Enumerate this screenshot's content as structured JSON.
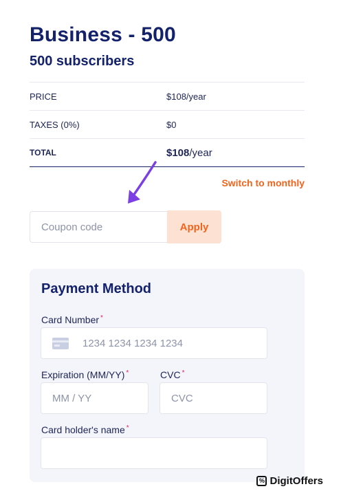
{
  "plan": {
    "title": "Business - 500",
    "subtitle": "500 subscribers"
  },
  "summary": {
    "price_label": "PRICE",
    "price_value": "$108/year",
    "taxes_label": "TAXES (0%)",
    "taxes_value": "$0",
    "total_label": "TOTAL",
    "total_amount": "$108",
    "total_suffix": "/year"
  },
  "switch_link": "Switch to monthly",
  "coupon": {
    "placeholder": "Coupon code",
    "apply_label": "Apply"
  },
  "payment": {
    "heading": "Payment Method",
    "card_number_label": "Card Number",
    "card_number_placeholder": "1234 1234 1234 1234",
    "expiration_label": "Expiration (MM/YY)",
    "expiration_placeholder": "MM / YY",
    "cvc_label": "CVC",
    "cvc_placeholder": "CVC",
    "holder_label": "Card holder's name",
    "required_mark": "*"
  },
  "watermark": {
    "icon_glyph": "%",
    "text": "DigitOffers"
  },
  "colors": {
    "primary": "#13226b",
    "accent": "#f0641e",
    "arrow": "#7b3fe4",
    "panel": "#f4f5fb"
  }
}
